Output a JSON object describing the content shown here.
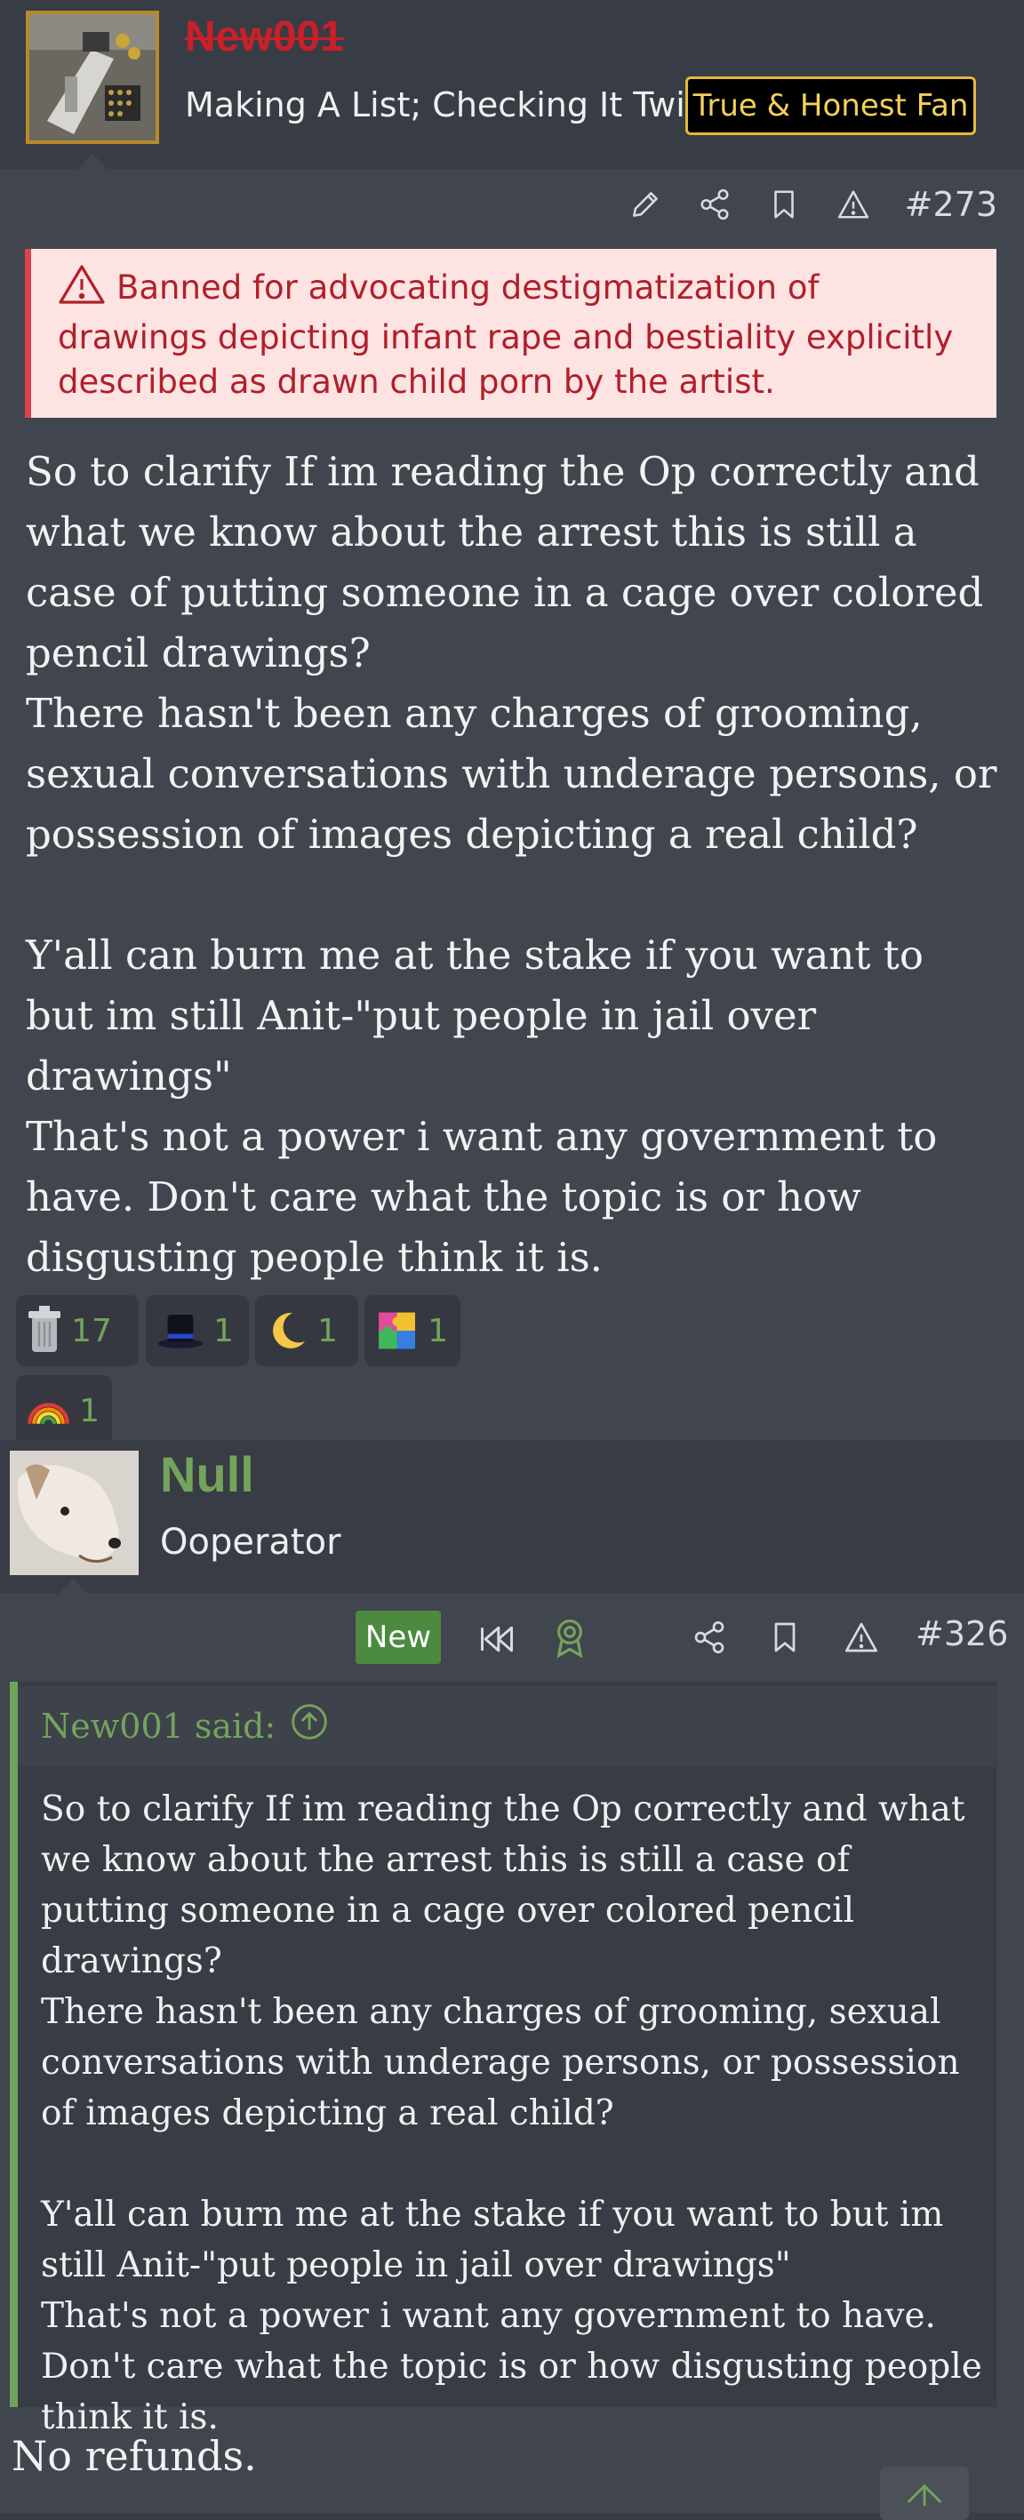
{
  "post1": {
    "username": "New001",
    "user_title": "Making A List; Checking It Twice",
    "user_banner": "True & Honest Fan",
    "post_number": "#273",
    "ban_notice": "Banned for advocating destigmatization of drawings depicting infant rape and bestiality explicitly described as drawn child porn by the artist.",
    "message": "So to clarify If im reading the Op correctly and what we know about the arrest this is still a case of putting someone in a cage over colored pencil drawings?\nThere hasn't been any charges of grooming, sexual conversations with underage persons, or possession of images depicting a real child?\n\nY'all can burn me at the stake if you want to but im still Anit-\"put people in jail over drawings\"\nThat's not a power i want any government to have. Don't care what the topic is or how disgusting people think it is.",
    "reactions": [
      {
        "icon": "trash-can-icon",
        "count": "17"
      },
      {
        "icon": "top-hat-icon",
        "count": "1"
      },
      {
        "icon": "crescent-moon-icon",
        "count": "1"
      },
      {
        "icon": "puzzle-piece-icon",
        "count": "1"
      },
      {
        "icon": "rainbow-icon",
        "count": "1"
      }
    ]
  },
  "post2": {
    "username": "Null",
    "user_title": "Ooperator",
    "new_badge": "New",
    "post_number": "#326",
    "quote_author": "New001 said:",
    "quote_text": "So to clarify If im reading the Op correctly and what we know about the arrest this is still a case of putting someone in a cage over colored pencil drawings?\nThere hasn't been any charges of grooming, sexual conversations with underage persons, or possession of images depicting a real child?\n\nY'all can burn me at the stake if you want to but im still Anit-\"put people in jail over drawings\"\nThat's not a power i want any government to have. Don't care what the topic is or how disgusting people think it is.",
    "message": "No refunds."
  },
  "colors": {
    "background": "#383c45",
    "post_body": "#41454e",
    "accent_green": "#74a35c",
    "ban_red": "#c9202a",
    "banner_gold": "#e2b93b"
  }
}
